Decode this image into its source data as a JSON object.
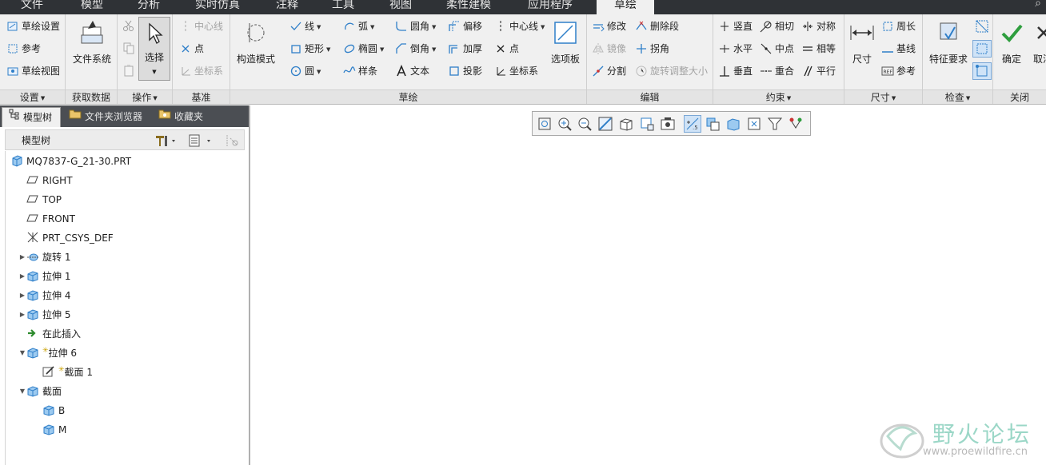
{
  "tabs": [
    {
      "label": "文件",
      "active": false
    },
    {
      "label": "模型",
      "active": false
    },
    {
      "label": "分析",
      "active": false
    },
    {
      "label": "实时仿真",
      "active": false
    },
    {
      "label": "注释",
      "active": false
    },
    {
      "label": "工具",
      "active": false
    },
    {
      "label": "视图",
      "active": false
    },
    {
      "label": "柔性建模",
      "active": false
    },
    {
      "label": "应用程序",
      "active": false
    },
    {
      "label": "草绘",
      "active": true
    }
  ],
  "ribbon": {
    "setup": {
      "items": [
        "草绘设置",
        "参考",
        "草绘视图"
      ],
      "label": "设置"
    },
    "get_data": {
      "file_system": "文件系统",
      "label": "获取数据"
    },
    "operations": {
      "select": "选择",
      "label": "操作"
    },
    "datum": {
      "items": [
        "中心线",
        "点",
        "坐标系"
      ],
      "label": "基准"
    },
    "construction": {
      "label": "构造模式"
    },
    "sketching": {
      "col1": [
        "线",
        "矩形",
        "圆"
      ],
      "col2": [
        "弧",
        "椭圆",
        "样条"
      ],
      "col3": [
        "圆角",
        "倒角",
        "文本"
      ],
      "col4": [
        "偏移",
        "加厚",
        "投影"
      ],
      "col5": [
        "中心线",
        "点",
        "坐标系"
      ],
      "palette": "选项板",
      "label": "草绘"
    },
    "editing": {
      "items": [
        "修改",
        "删除段",
        "镜像",
        "拐角",
        "分割",
        "旋转调整大小"
      ],
      "label": "编辑"
    },
    "constrain": {
      "items": [
        "竖直",
        "相切",
        "对称",
        "水平",
        "中点",
        "相等",
        "垂直",
        "重合",
        "平行"
      ],
      "label": "约束"
    },
    "dimension": {
      "main": "尺寸",
      "items": [
        "周长",
        "基线",
        "参考"
      ],
      "label": "尺寸"
    },
    "inspect": {
      "main": "特征要求",
      "label": "检查"
    },
    "close": {
      "ok": "确定",
      "cancel": "取消",
      "label": "关闭"
    }
  },
  "panel": {
    "tabs": [
      "模型树",
      "文件夹浏览器",
      "收藏夹"
    ],
    "tree_title": "模型树",
    "tree": [
      {
        "label": "MQ7837-G_21-30.PRT",
        "icon": "part-icon"
      },
      {
        "label": "RIGHT",
        "icon": "datum-plane-icon"
      },
      {
        "label": "TOP",
        "icon": "datum-plane-icon"
      },
      {
        "label": "FRONT",
        "icon": "datum-plane-icon"
      },
      {
        "label": "PRT_CSYS_DEF",
        "icon": "csys-icon"
      },
      {
        "label": "旋转 1",
        "icon": "revolve-icon"
      },
      {
        "label": "拉伸 1",
        "icon": "extrude-icon"
      },
      {
        "label": "拉伸 4",
        "icon": "extrude-icon"
      },
      {
        "label": "拉伸 5",
        "icon": "extrude-icon"
      },
      {
        "label": "在此插入",
        "icon": "insert-here-icon"
      },
      {
        "label": "拉伸 6",
        "icon": "extrude-icon"
      },
      {
        "label": "截面 1",
        "icon": "sketch-icon"
      },
      {
        "label": "截面",
        "icon": "section-icon"
      },
      {
        "label": "B",
        "icon": "section-icon"
      },
      {
        "label": "M",
        "icon": "section-icon"
      }
    ]
  },
  "watermark": {
    "text": "野火论坛",
    "url": "www.proewildfire.cn"
  },
  "colors": {
    "tabbar": "#2f3236",
    "ribbon": "#f0f0f0",
    "panel_tabs": "#4b4e53",
    "ok_green": "#2e9e3e",
    "icon_blue": "#2f7fc9"
  }
}
